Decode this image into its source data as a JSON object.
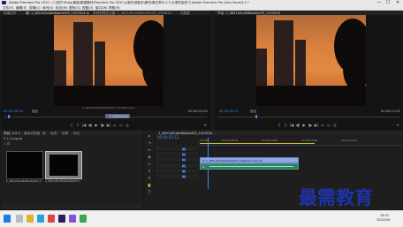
{
  "window": {
    "title": "Adobe Premiere Pro 2020 - C:\\用户\\Pchg\\桌面\\数据素材\\Premiere Pro 2020 从新手到高手\\素材\\第五章\\5.2.3 从零开始学习 Adobe Premiere Pro Auto Save\\3.0 *",
    "minimize": "—",
    "maximize": "☐",
    "close": "✕"
  },
  "menu": [
    "文件(F)",
    "编辑(E)",
    "剪辑(C)",
    "序列(S)",
    "标记(M)",
    "图形(G)",
    "视图(V)",
    "窗口(W)",
    "帮助(H)"
  ],
  "source_panel": {
    "tabs": [
      "效果控件",
      "源: 1_4851d5cd9d6ad5e0f3_1023024.mp4",
      "音频剪辑混合器: 1_4851d5cd9d6ad5e0f3_1023024",
      "元数据"
    ],
    "clip_label": "1_4851d5cd9d6ad5e0f3_1023024.mp4",
    "timecode_left": "00:00:00:16",
    "fit": "适合",
    "timecode_right": "00:00:22:00",
    "marker_label": "1:2/4851d5c",
    "controls": [
      "{",
      "}",
      "|◀",
      "◀|",
      "▶",
      "|▶",
      "▶|",
      "▭",
      "▭",
      "◎",
      "+"
    ]
  },
  "program_panel": {
    "tabs": [
      "节目: 1_4851d5cd9d6ad5e0f3_1023024"
    ],
    "timecode_left": "00:00:02:12",
    "fit": "适合",
    "timecode_right": "00:00:11:02",
    "controls": [
      "{",
      "}",
      "|◀",
      "◀|",
      "▶",
      "|▶",
      "▶|",
      "▭",
      "▭",
      "◎",
      "+"
    ]
  },
  "project_panel": {
    "tabs": [
      "项目: 5.2.3",
      "媒体浏览器",
      "库",
      "信息",
      "效果",
      "标记"
    ],
    "project_name": "5.2.3.prproj",
    "item_count": "2 项",
    "items": [
      {
        "name": "1_4851d5cd9d6ad5e0f3_1023024",
        "duration": "22:00"
      },
      {
        "name": "1_4851d5cd9d6ad5e0f3_1023024",
        "duration": "22:00"
      }
    ]
  },
  "tools": [
    "▸",
    "⇥",
    "↔",
    "◈",
    "✂",
    "↕",
    "✎",
    "✋",
    "T"
  ],
  "timeline": {
    "tab": "1_4851d5cd9d6ad5e0f3_1023024",
    "timecode": "00:00:02:12",
    "ruler": [
      "00:00",
      "00:00:05:00",
      "00:00:10:00",
      "00:00:15:00",
      "00:00:20:00"
    ],
    "tracks": [
      {
        "label": "V3"
      },
      {
        "label": "V2"
      },
      {
        "label": "V1"
      },
      {
        "label": "A1"
      },
      {
        "label": "A2"
      },
      {
        "label": "A3"
      }
    ],
    "video_clip": "fx 1_4851d5cd9d6ad5e0f3_1023024.mp4 [V]",
    "audio_clip": "fx"
  },
  "taskbar": {
    "time": "19:15",
    "date": "2020/2/8"
  },
  "watermark": "最需教育",
  "colors": {
    "accent_blue": "#3b8bff",
    "track_clip_video": "#8fa6e8",
    "track_clip_audio": "#2f7d63",
    "watermark": "#1f33a8"
  }
}
